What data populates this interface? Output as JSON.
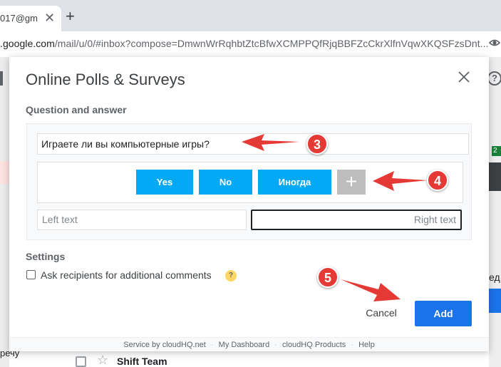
{
  "browser": {
    "tab_title": "017@gm",
    "tab_close": "✕",
    "new_tab": "+",
    "url_host": ".google.com",
    "url_path": "/mail/u/0/#inbox?compose=DmwnWrRqhbtZtcBfwXCMPPQfRjqBBFZcCkrXlfnVqwXKQSFzsDnt..."
  },
  "gmail_background": {
    "help_icon": "?",
    "badge": "2",
    "side_text": "ед",
    "bottom_word": "речу",
    "star": "☆",
    "row_sender": "Shift Team"
  },
  "dialog": {
    "title": "Online Polls & Surveys",
    "close_icon": "close-icon",
    "question_section_label": "Question and answer",
    "question_value": "Играете ли вы компьютерные игры?",
    "answers": [
      {
        "label": "Yes"
      },
      {
        "label": "No"
      },
      {
        "label": "Иногда"
      }
    ],
    "add_answer_label": "+",
    "left_text_placeholder": "Left text",
    "right_text_placeholder": "Right text",
    "settings_label": "Settings",
    "additional_comments_label": "Ask recipients for additional comments",
    "hint_label": "?",
    "cancel_label": "Cancel",
    "add_label": "Add",
    "footer": {
      "service_by": "Service by cloudHQ.net",
      "dashboard": "My Dashboard",
      "products": "cloudHQ Products",
      "help": "Help",
      "separator": "·"
    }
  },
  "annotations": {
    "marker_3": "3",
    "marker_4": "4",
    "marker_5": "5",
    "color": "#e53935"
  },
  "colors": {
    "answer_button": "#03a9f4",
    "add_button": "#1a73e8",
    "add_answer_button": "#bdbdbd"
  }
}
